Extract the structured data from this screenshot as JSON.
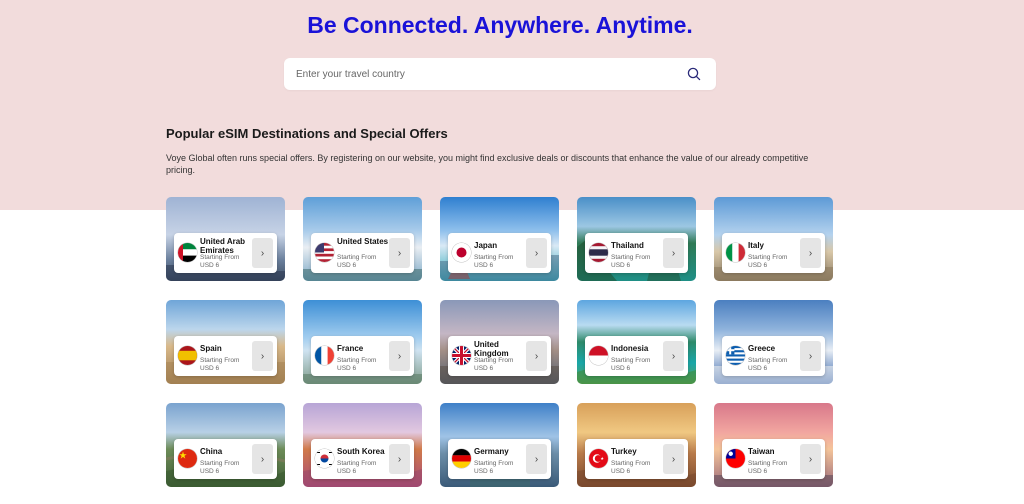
{
  "hero": {
    "headline": "Be Connected. Anywhere. Anytime.",
    "search_placeholder": "Enter your travel country"
  },
  "section": {
    "title": "Popular eSIM Destinations and Special Offers",
    "description": "Voye Global often runs special offers. By registering on our website, you might find exclusive deals or discounts that enhance the value of our already competitive pricing."
  },
  "colors": {
    "hero_bg": "#f2dcdc",
    "headline": "#1a12d8"
  },
  "destinations": [
    {
      "name": "United Arab Emirates",
      "starting_from": "Starting From",
      "price": "USD 6",
      "flag": "uae-flag-icon"
    },
    {
      "name": "United States",
      "starting_from": "Starting From",
      "price": "USD 6",
      "flag": "us-flag-icon"
    },
    {
      "name": "Japan",
      "starting_from": "Starting From",
      "price": "USD 6",
      "flag": "japan-flag-icon"
    },
    {
      "name": "Thailand",
      "starting_from": "Starting From",
      "price": "USD 6",
      "flag": "thailand-flag-icon"
    },
    {
      "name": "Italy",
      "starting_from": "Starting From",
      "price": "USD 6",
      "flag": "italy-flag-icon"
    },
    {
      "name": "Spain",
      "starting_from": "Starting From",
      "price": "USD 6",
      "flag": "spain-flag-icon"
    },
    {
      "name": "France",
      "starting_from": "Starting From",
      "price": "USD 6",
      "flag": "france-flag-icon"
    },
    {
      "name": "United Kingdom",
      "starting_from": "Starting From",
      "price": "USD 6",
      "flag": "uk-flag-icon"
    },
    {
      "name": "Indonesia",
      "starting_from": "Starting From",
      "price": "USD 6",
      "flag": "indonesia-flag-icon"
    },
    {
      "name": "Greece",
      "starting_from": "Starting From",
      "price": "USD 6",
      "flag": "greece-flag-icon"
    },
    {
      "name": "China",
      "starting_from": "Starting From",
      "price": "USD 6",
      "flag": "china-flag-icon"
    },
    {
      "name": "South Korea",
      "starting_from": "Starting From",
      "price": "USD 6",
      "flag": "south-korea-flag-icon"
    },
    {
      "name": "Germany",
      "starting_from": "Starting From",
      "price": "USD 6",
      "flag": "germany-flag-icon"
    },
    {
      "name": "Turkey",
      "starting_from": "Starting From",
      "price": "USD 6",
      "flag": "turkey-flag-icon"
    },
    {
      "name": "Taiwan",
      "starting_from": "Starting From",
      "price": "USD 6",
      "flag": "taiwan-flag-icon"
    }
  ],
  "icons": {
    "search": "search-icon",
    "arrow": "chevron-right-icon"
  }
}
